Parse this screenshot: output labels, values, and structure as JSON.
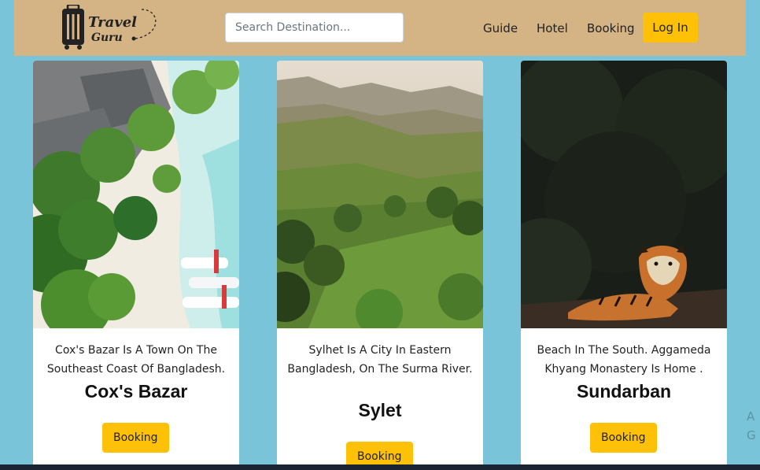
{
  "brand": {
    "word1": "Travel",
    "word2": "Guru"
  },
  "search": {
    "placeholder": "Search Destination...",
    "value": ""
  },
  "nav": {
    "guide": "Guide",
    "hotel": "Hotel",
    "booking": "Booking",
    "login": "Log In"
  },
  "cards": [
    {
      "description": "Cox's Bazar Is A Town On The Southeast Coast Of Bangladesh.",
      "title": "Cox's Bazar",
      "button": "Booking",
      "image": "beach-resort-aerial-photo"
    },
    {
      "description": "Sylhet Is A City In Eastern Bangladesh, On The Surma River.",
      "title": "Sylet",
      "button": "Booking",
      "image": "green-hills-tea-garden-photo"
    },
    {
      "description": "Beach In The South. Aggameda Khyang Monastery Is Home .",
      "title": "Sundarban",
      "button": "Booking",
      "image": "tiger-in-forest-photo"
    }
  ],
  "colors": {
    "background": "#79c4d9",
    "header": "#d4b385",
    "accent": "#ffc107"
  },
  "side_fragment": {
    "line1": "A",
    "line2": "G"
  }
}
